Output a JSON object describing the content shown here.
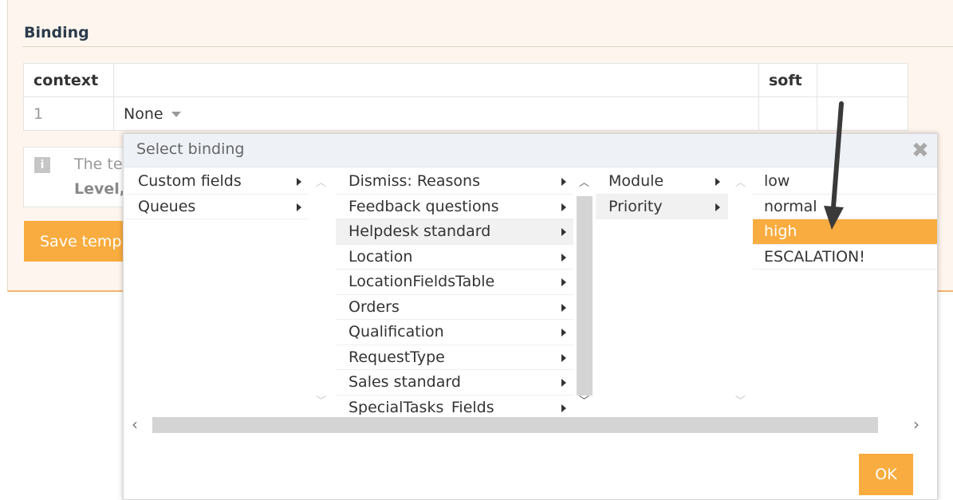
{
  "section": {
    "title": "Binding"
  },
  "table": {
    "headers": [
      "context",
      "",
      "soft",
      ""
    ],
    "row": {
      "num": "1",
      "value": "None",
      "soft": "",
      "extra": ""
    }
  },
  "info": {
    "icon": "info-icon",
    "line1": "The te",
    "line2": "Level,"
  },
  "save_button": "Save temp",
  "modal": {
    "title": "Select binding",
    "close_icon": "close-icon",
    "col1": [
      "Custom fields",
      "Queues"
    ],
    "col2": [
      "Dismiss: Reasons",
      "Feedback questions",
      "Helpdesk standard",
      "Location",
      "LocationFieldsTable",
      "Orders",
      "Qualification",
      "RequestType",
      "Sales standard",
      "SpecialTasks_Fields"
    ],
    "col3": [
      "Module",
      "Priority"
    ],
    "col4": [
      "low",
      "normal",
      "high",
      "ESCALATION!"
    ],
    "ok_button": "OK"
  },
  "colors": {
    "accent": "#f9ac3f",
    "panel_bg": "#fef6ee",
    "modal_header": "#eef1f6"
  }
}
